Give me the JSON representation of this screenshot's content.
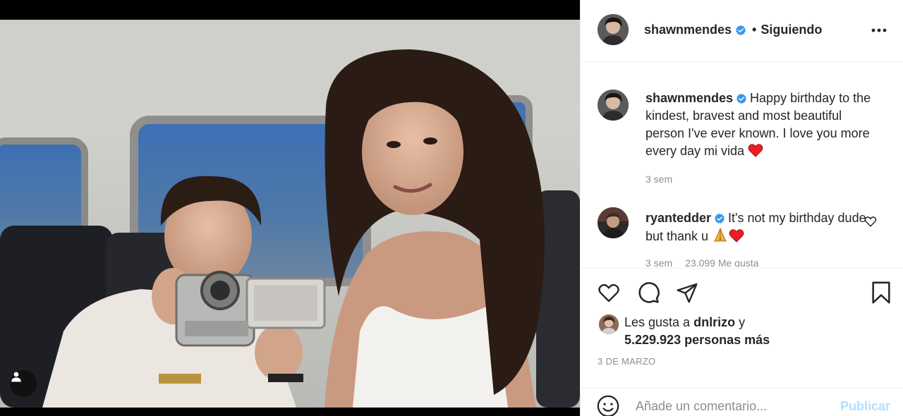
{
  "header": {
    "username": "shawnmendes",
    "separator": "•",
    "follow_status": "Siguiendo"
  },
  "caption": {
    "username": "shawnmendes",
    "text": "Happy birthday to the kindest, bravest and most beautiful person I've ever known. I love you more every day mi vida",
    "emoji": "heart",
    "time": "3 sem"
  },
  "comment": {
    "username": "ryantedder",
    "text": "It's not my birthday dude but thank u",
    "emojis": [
      "folded-hands",
      "heart"
    ],
    "time": "3 sem",
    "likes": "23.099 Me gusta"
  },
  "likes": {
    "prefix": "Les gusta a",
    "user": "dnlrizo",
    "joiner": "y",
    "others": "5.229.923 personas más"
  },
  "post_date": "3 DE MARZO",
  "add_comment": {
    "placeholder": "Añade un comentario...",
    "publish_label": "Publicar"
  },
  "colors": {
    "verified": "#3897f0",
    "heart": "#ed1c24",
    "publish_disabled": "#b2dffc",
    "muted": "#8e8e8e"
  },
  "icons": [
    "verified-icon",
    "more-options-icon",
    "like-icon",
    "comment-icon",
    "share-icon",
    "save-icon",
    "emoji-icon",
    "user-tag-icon"
  ]
}
